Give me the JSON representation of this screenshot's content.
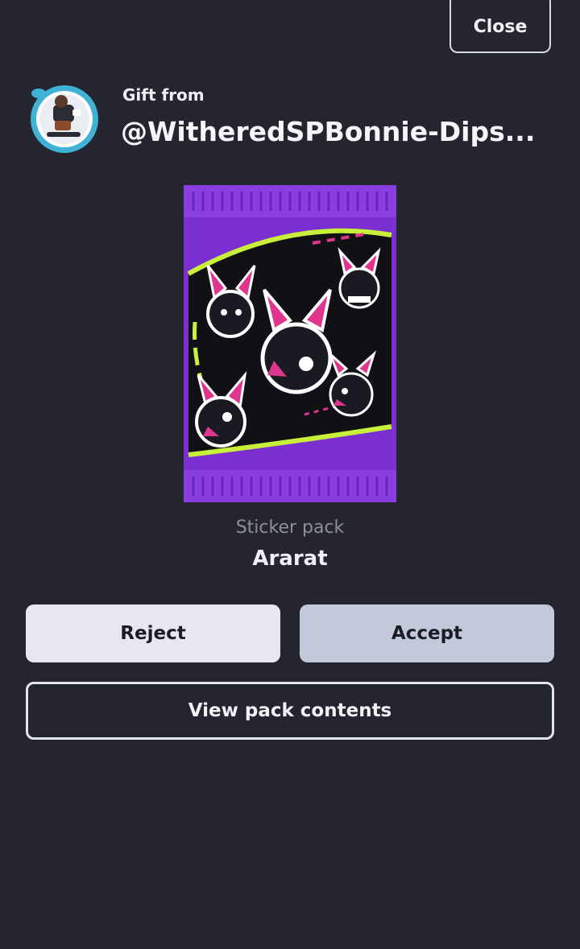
{
  "header": {
    "close_label": "Close"
  },
  "gift": {
    "from_label": "Gift from",
    "sender": "@WitheredSPBonnie-Dips..."
  },
  "pack": {
    "type_label": "Sticker pack",
    "name": "Ararat"
  },
  "actions": {
    "reject_label": "Reject",
    "accept_label": "Accept",
    "view_label": "View pack contents"
  },
  "colors": {
    "background": "#24252f",
    "pack_purple": "#7b2fd0",
    "accent_pink": "#e0358f",
    "accent_lime": "#c8f03a"
  }
}
